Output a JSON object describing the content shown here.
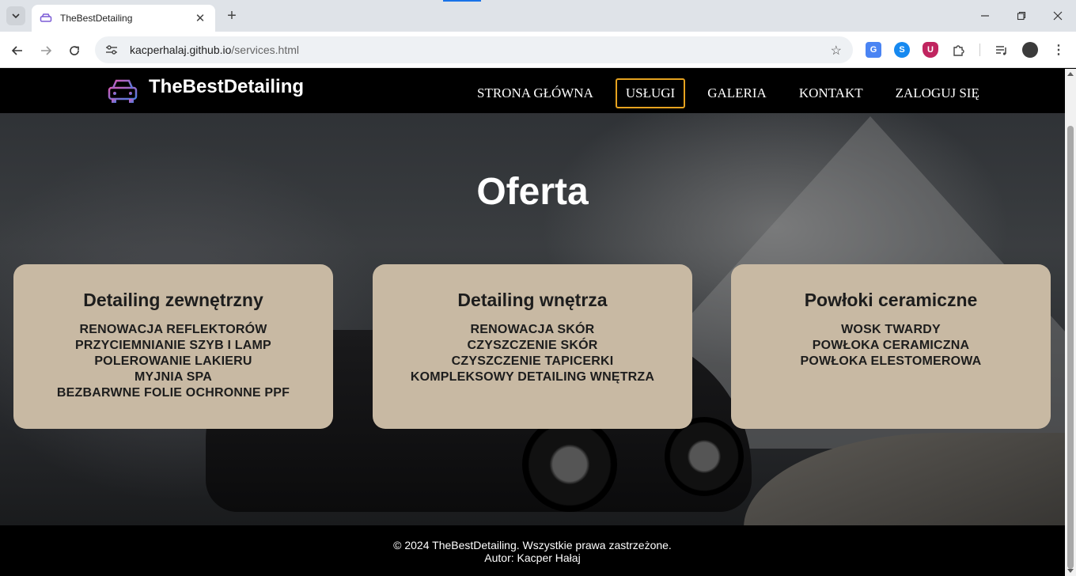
{
  "browser": {
    "tab_title": "TheBestDetailing",
    "url_host": "kacperhalaj.github.io",
    "url_path": "/services.html",
    "icons": {
      "tab_search": "chevron-down-icon",
      "tab_close": "close-icon",
      "new_tab": "plus-icon",
      "minimize": "minimize-icon",
      "maximize": "restore-icon",
      "close_window": "close-icon",
      "back": "arrow-left-icon",
      "forward": "arrow-right-icon",
      "reload": "reload-icon",
      "site_info": "tune-icon",
      "bookmark": "star-icon",
      "translate": "translate-icon",
      "shazam": "shazam-icon",
      "ublock": "shield-icon",
      "extensions": "puzzle-icon",
      "media": "media-control-icon",
      "profile": "avatar",
      "menu": "kebab-menu-icon"
    }
  },
  "header": {
    "logo_text": "TheBestDetailing",
    "nav": [
      {
        "label": "STRONA GŁÓWNA",
        "active": false
      },
      {
        "label": "USŁUGI",
        "active": true
      },
      {
        "label": "GALERIA",
        "active": false
      },
      {
        "label": "KONTAKT",
        "active": false
      },
      {
        "label": "ZALOGUJ SIĘ",
        "active": false
      }
    ]
  },
  "hero": {
    "title": "Oferta"
  },
  "cards": [
    {
      "title": "Detailing zewnętrzny",
      "items": [
        "RENOWACJA REFLEKTORÓW",
        "PRZYCIEMNIANIE SZYB I LAMP",
        "POLEROWANIE LAKIERU",
        "MYJNIA SPA",
        "BEZBARWNE FOLIE OCHRONNE PPF"
      ]
    },
    {
      "title": "Detailing wnętrza",
      "items": [
        "RENOWACJA SKÓR",
        "CZYSZCZENIE SKÓR",
        "CZYSZCZENIE TAPICERKI",
        "KOMPLEKSOWY DETAILING WNĘTRZA"
      ]
    },
    {
      "title": "Powłoki ceramiczne",
      "items": [
        "WOSK TWARDY",
        "POWŁOKA CERAMICZNA",
        "POWŁOKA ELESTOMEROWA"
      ]
    }
  ],
  "footer": {
    "line1": "© 2024 TheBestDetailing. Wszystkie prawa zastrzeżone.",
    "line2": "Autor: Kacper Hałaj"
  },
  "colors": {
    "card_bg": "#c8b9a3",
    "nav_active_border": "#e6a21f",
    "header_bg": "#000000"
  }
}
